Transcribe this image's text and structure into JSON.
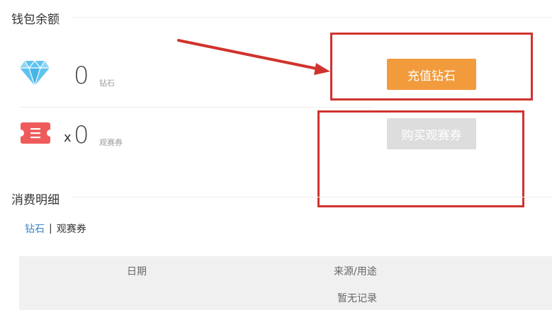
{
  "wallet": {
    "title": "钱包余额",
    "diamond": {
      "icon": "diamond-icon",
      "value": "0",
      "unit": "钻石",
      "color": "#5ec3ef"
    },
    "ticket": {
      "icon": "ticket-icon",
      "prefix": "x",
      "value": "0",
      "unit": "观赛券",
      "color": "#ef5b5b"
    },
    "recharge_button": "充值钻石",
    "buy_ticket_button": "购买观赛券"
  },
  "consumption": {
    "title": "消费明细",
    "tabs": [
      {
        "label": "钻石",
        "active": true
      },
      {
        "label": "观赛券",
        "active": false
      }
    ],
    "tab_separator": "|",
    "table": {
      "columns": [
        "日期",
        "来源/用途"
      ],
      "empty_text": "暂无记录"
    }
  },
  "colors": {
    "accent": "#f29b3d",
    "annotation": "#d0332e",
    "link": "#3a87c8"
  }
}
